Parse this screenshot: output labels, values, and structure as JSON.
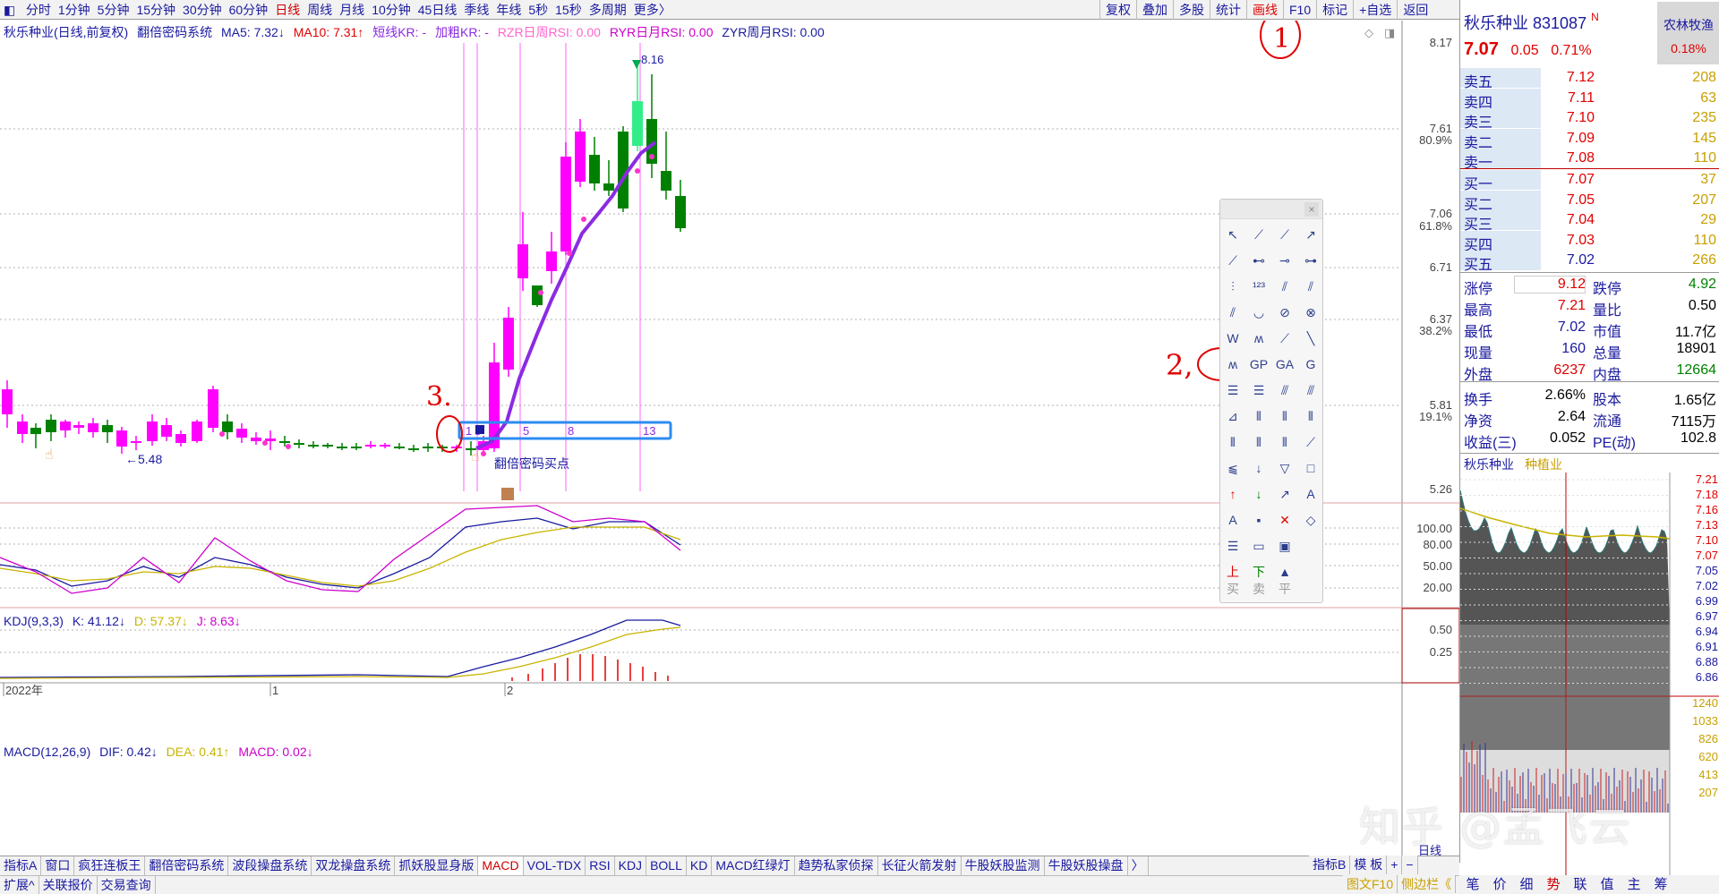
{
  "colors": {
    "up": "#ff00ff",
    "down": "#008000",
    "ma5": "#8b2be2",
    "red": "#e00000",
    "green": "#008000",
    "blue": "#1a1aa0",
    "grid": "#b0b0b0"
  },
  "topbar": {
    "items": [
      "分时",
      "1分钟",
      "5分钟",
      "15分钟",
      "30分钟",
      "60分钟",
      "日线",
      "周线",
      "月线",
      "10分钟",
      "45日线",
      "季线",
      "年线",
      "5秒",
      "15秒",
      "多周期",
      "更多〉"
    ],
    "active": "日线",
    "right_items": [
      "复权",
      "叠加",
      "多股",
      "统计",
      "画线",
      "F10",
      "标记",
      "+自选",
      "返回"
    ]
  },
  "chart_header": {
    "name": "秋乐种业(日线,前复权)",
    "system": "翻倍密码系统",
    "ma5": "MA5: 7.32↓",
    "ma10": "MA10: 7.31↑",
    "kr": "短线KR: -",
    "jc": "加粗KR: -",
    "rzr": "RZR日周RSI: 0.00",
    "ryr": "RYR日月RSI: 0.00",
    "zyr": "ZYR周月RSI: 0.00"
  },
  "price_axis": [
    "8.17",
    "7.61",
    "7.06",
    "6.71",
    "6.37",
    "5.81",
    "5.26"
  ],
  "pct_axis": [
    "80.9%",
    "61.8%",
    "38.2%",
    "19.1%"
  ],
  "annotations": {
    "low_label": "←5.48",
    "high_label": "8.16",
    "buy_point": "翻倍密码买点",
    "fib_numbers": [
      "1",
      "3",
      "5",
      "8",
      "13"
    ],
    "hand_1": "1",
    "hand_2": "2,",
    "hand_3": "3."
  },
  "kdj": {
    "title": "KDJ(9,3,3)",
    "k": "K: 41.12↓",
    "d": "D: 57.37↓",
    "j": "J: 8.63↓",
    "axis": [
      "100.00",
      "80.00",
      "50.00",
      "20.00"
    ]
  },
  "macd": {
    "title": "MACD(12,26,9)",
    "dif": "DIF: 0.42↓",
    "dea": "DEA: 0.41↑",
    "macd": "MACD: 0.02↓",
    "axis": [
      "0.50",
      "0.25"
    ]
  },
  "date_axis": [
    "2022年",
    "1",
    "2"
  ],
  "period_label": "日线",
  "bottom_tabs": [
    "指标A",
    "窗口",
    "疯狂连板王",
    "翻倍密码系统",
    "波段操盘系统",
    "双龙操盘系统",
    "抓妖股显身版",
    "MACD",
    "VOL-TDX",
    "RSI",
    "KDJ",
    "BOLL",
    "KD",
    "MACD红绿灯",
    "趋势私家侦探",
    "长征火箭发射",
    "牛股妖股监测",
    "牛股妖股操盘",
    "〉"
  ],
  "bottom_tabs_active": "MACD",
  "bottom_right_tabs": [
    "指标B",
    "模 板",
    "+",
    "−"
  ],
  "bottom_bar2": [
    "扩展^",
    "关联报价",
    "交易查询"
  ],
  "bottom_bar2_right": [
    "图文F10",
    "侧边栏《"
  ],
  "stock": {
    "name": "秋乐种业",
    "code": "831087",
    "badge": "N",
    "sector": "农林牧渔",
    "sector_pct": "0.18%",
    "price": "7.07",
    "change": "0.05",
    "change_pct": "0.71%"
  },
  "order_book": {
    "asks": [
      {
        "label": "卖五",
        "price": "7.12",
        "vol": "208"
      },
      {
        "label": "卖四",
        "price": "7.11",
        "vol": "63"
      },
      {
        "label": "卖三",
        "price": "7.10",
        "vol": "235"
      },
      {
        "label": "卖二",
        "price": "7.09",
        "vol": "145"
      },
      {
        "label": "卖一",
        "price": "7.08",
        "vol": "110"
      }
    ],
    "bids": [
      {
        "label": "买一",
        "price": "7.07",
        "vol": "37"
      },
      {
        "label": "买二",
        "price": "7.05",
        "vol": "207"
      },
      {
        "label": "买三",
        "price": "7.04",
        "vol": "29"
      },
      {
        "label": "买四",
        "price": "7.03",
        "vol": "110"
      },
      {
        "label": "买五",
        "price": "7.02",
        "vol": "266"
      }
    ]
  },
  "stats": [
    {
      "l1": "涨停",
      "v1": "9.12",
      "l2": "跌停",
      "v2": "4.92"
    },
    {
      "l1": "最高",
      "v1": "7.21",
      "l2": "量比",
      "v2": "0.50"
    },
    {
      "l1": "最低",
      "v1": "7.02",
      "l2": "市值",
      "v2": "11.7亿"
    },
    {
      "l1": "现量",
      "v1": "160",
      "l2": "总量",
      "v2": "18901"
    },
    {
      "l1": "外盘",
      "v1": "6237",
      "l2": "内盘",
      "v2": "12664"
    },
    {
      "l1": "换手",
      "v1": "2.66%",
      "l2": "股本",
      "v2": "1.65亿"
    },
    {
      "l1": "净资",
      "v1": "2.64",
      "l2": "流通",
      "v2": "7115万"
    },
    {
      "l1": "收益(三)",
      "v1": "0.052",
      "l2": "PE(动)",
      "v2": "102.8"
    }
  ],
  "mini": {
    "name": "秋乐种业",
    "sector": "种植业",
    "axis": [
      "7.21",
      "7.18",
      "7.16",
      "7.13",
      "7.10",
      "7.07",
      "7.05",
      "7.02",
      "6.99",
      "6.97",
      "6.94",
      "6.91",
      "6.88",
      "6.86"
    ],
    "vol_axis": [
      "1240",
      "1033",
      "826",
      "620",
      "413",
      "207"
    ]
  },
  "side_tabs": [
    "笔",
    "价",
    "细",
    "势",
    "联",
    "值",
    "主",
    "筹"
  ],
  "side_tabs_active": "势",
  "watermark": "知乎 @孟飞云",
  "toolbox_footer": [
    "买",
    "卖",
    "平"
  ]
}
